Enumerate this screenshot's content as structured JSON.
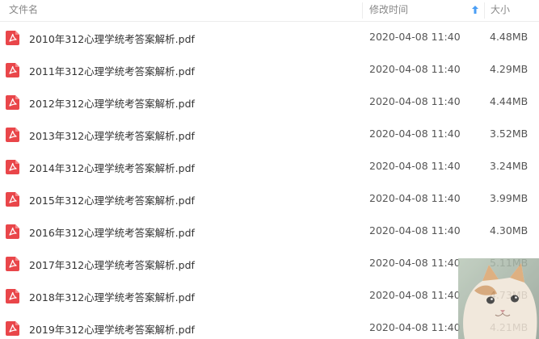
{
  "header": {
    "name_label": "文件名",
    "date_label": "修改时间",
    "size_label": "大小",
    "sort_icon": "arrow-up-icon"
  },
  "files": [
    {
      "name": "2010年312心理学统考答案解析.pdf",
      "modified": "2020-04-08 11:40",
      "size": "4.48MB"
    },
    {
      "name": "2011年312心理学统考答案解析.pdf",
      "modified": "2020-04-08 11:40",
      "size": "4.29MB"
    },
    {
      "name": "2012年312心理学统考答案解析.pdf",
      "modified": "2020-04-08 11:40",
      "size": "4.44MB"
    },
    {
      "name": "2013年312心理学统考答案解析.pdf",
      "modified": "2020-04-08 11:40",
      "size": "3.52MB"
    },
    {
      "name": "2014年312心理学统考答案解析.pdf",
      "modified": "2020-04-08 11:40",
      "size": "3.24MB"
    },
    {
      "name": "2015年312心理学统考答案解析.pdf",
      "modified": "2020-04-08 11:40",
      "size": "3.99MB"
    },
    {
      "name": "2016年312心理学统考答案解析.pdf",
      "modified": "2020-04-08 11:40",
      "size": "4.30MB"
    },
    {
      "name": "2017年312心理学统考答案解析.pdf",
      "modified": "2020-04-08 11:40",
      "size": "5.11MB"
    },
    {
      "name": "2018年312心理学统考答案解析.pdf",
      "modified": "2020-04-08 11:40",
      "size": "4.73MB"
    },
    {
      "name": "2019年312心理学统考答案解析.pdf",
      "modified": "2020-04-08 11:40",
      "size": "4.21MB"
    }
  ],
  "colors": {
    "pdf_icon": "#e9464a",
    "sort_arrow": "#4a9ef5"
  }
}
